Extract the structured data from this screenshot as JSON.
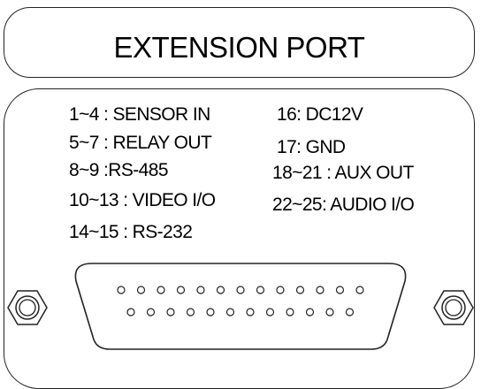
{
  "title": "EXTENSION PORT",
  "pin_labels_left": [
    "1~4 : SENSOR IN",
    "5~7 : RELAY OUT",
    "8~9 :RS-485",
    "10~13 : VIDEO I/O",
    "14~15 : RS-232"
  ],
  "pin_labels_right": [
    "16: DC12V",
    "17: GND",
    "18~21 : AUX OUT",
    "22~25: AUDIO I/O"
  ],
  "connector": {
    "type": "DB-25",
    "top_row_pins": 13,
    "bottom_row_pins": 12
  }
}
